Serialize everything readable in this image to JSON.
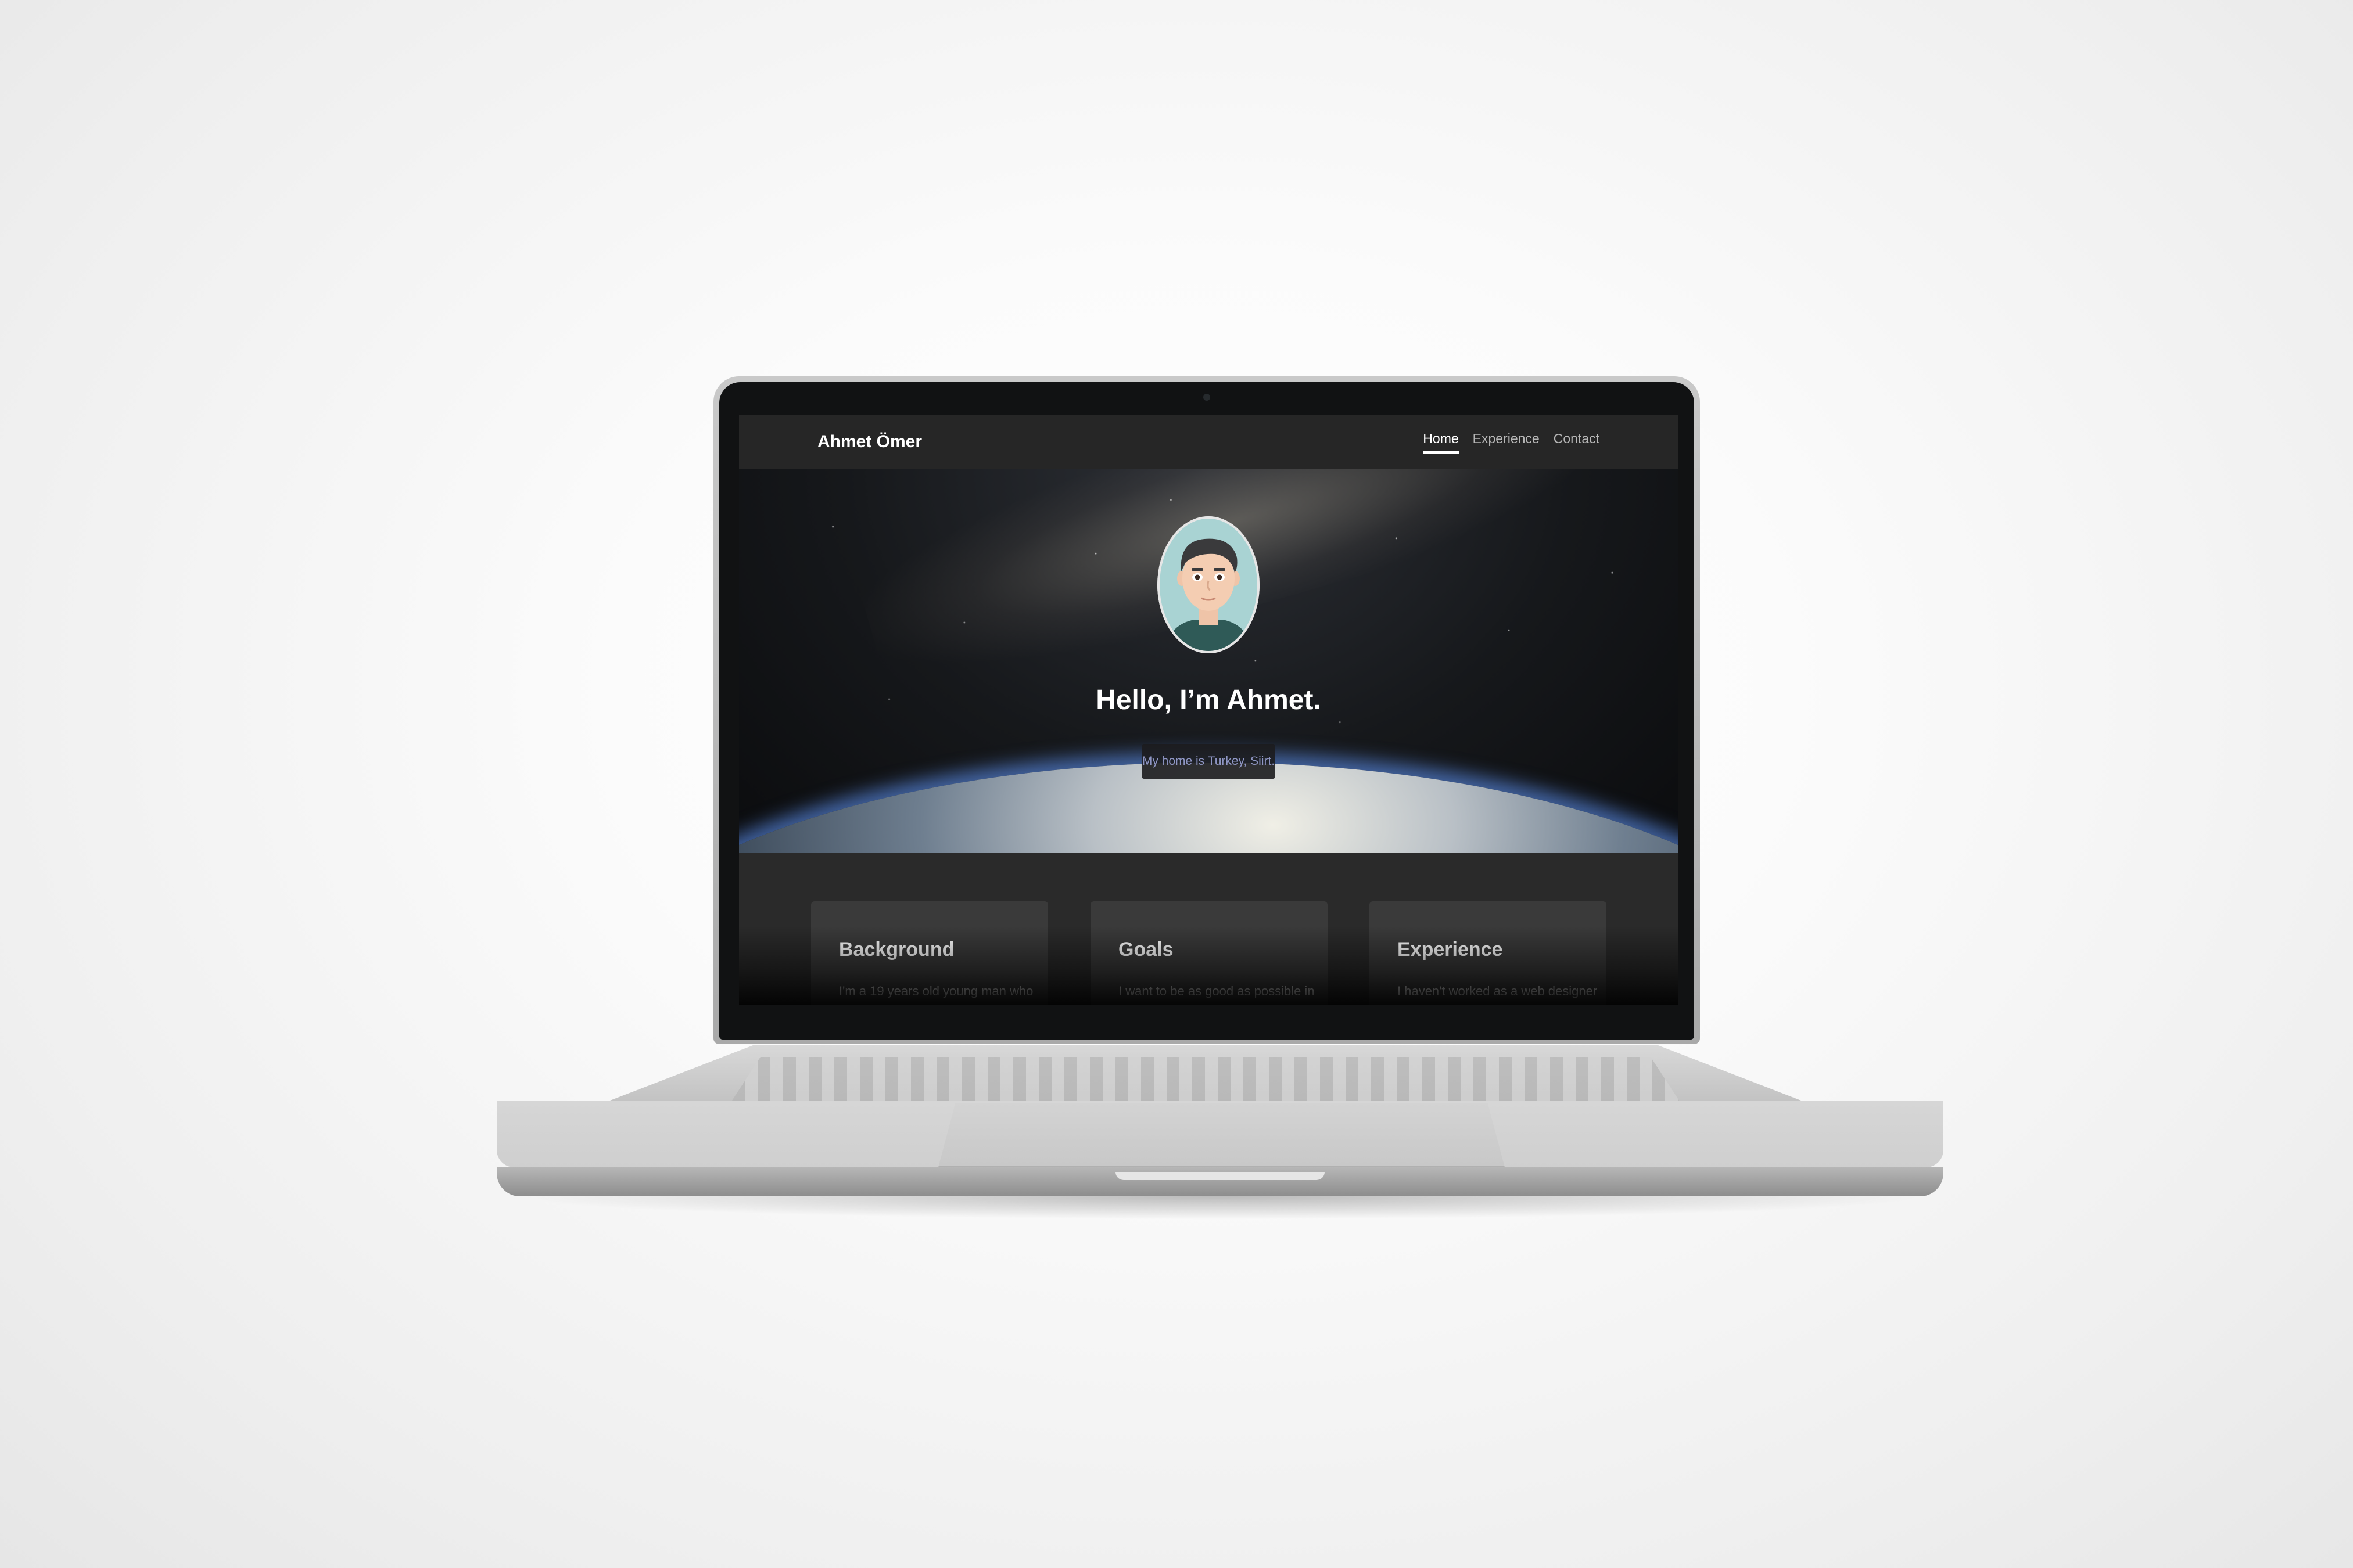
{
  "site": {
    "brand": "Ahmet Ömer",
    "nav": [
      {
        "label": "Home",
        "active": true
      },
      {
        "label": "Experience",
        "active": false
      },
      {
        "label": "Contact",
        "active": false
      }
    ]
  },
  "hero": {
    "title": "Hello, I’m Ahmet.",
    "subtitle": "My home is Turkey, Siirt."
  },
  "cards": [
    {
      "title": "Background",
      "text": "I'm a 19 years old young man who"
    },
    {
      "title": "Goals",
      "text": "I want to be as good as possible in"
    },
    {
      "title": "Experience",
      "text": "I haven't worked as a web designer"
    }
  ],
  "colors": {
    "navbar": "#262626",
    "card": "#3a3a3a",
    "subtitle_text": "#8f96c4"
  }
}
